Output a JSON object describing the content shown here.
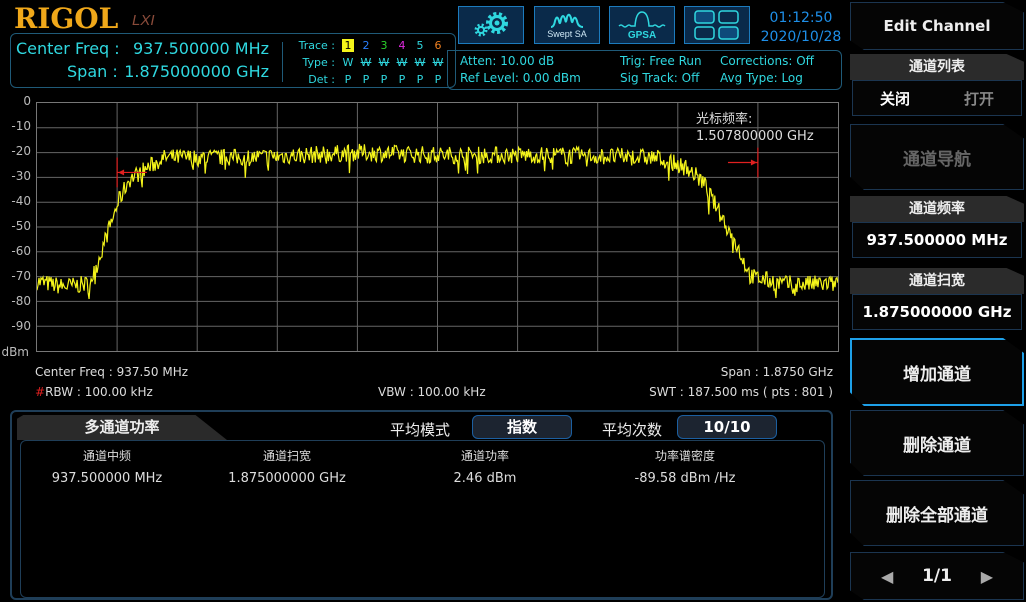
{
  "brand": {
    "logo": "RIGOL",
    "sub": "LXI"
  },
  "header": {
    "center_freq_label": "Center Freq :",
    "center_freq_value": "937.500000 MHz",
    "span_label": "Span :",
    "span_value": "1.875000000 GHz",
    "trace_label": "Trace :",
    "type_label": "Type :",
    "det_label": "Det :",
    "traces": [
      {
        "num": "1",
        "type": "W",
        "det": "P",
        "color": "#f5f51a",
        "active": true
      },
      {
        "num": "2",
        "type": "W",
        "det": "P",
        "color": "#2a7fff",
        "active": false
      },
      {
        "num": "3",
        "type": "W",
        "det": "P",
        "color": "#2ad02a",
        "active": false
      },
      {
        "num": "4",
        "type": "W",
        "det": "P",
        "color": "#e02ae0",
        "active": false
      },
      {
        "num": "5",
        "type": "W",
        "det": "P",
        "color": "#2fd8e0",
        "active": false
      },
      {
        "num": "6",
        "type": "W",
        "det": "P",
        "color": "#f08020",
        "active": false
      }
    ]
  },
  "toolbar": {
    "settings_icon": "gears-icon",
    "swept_sa_label": "Swept SA",
    "gpsa_label": "GPSA",
    "layout_icon": "window-layout-icon"
  },
  "clock": {
    "time": "01:12:50",
    "date": "2020/10/28"
  },
  "status": {
    "atten": "Atten: 10.00 dB",
    "ref_level": "Ref Level: 0.00 dBm",
    "trig": "Trig: Free Run",
    "sig_track": "Sig Track: Off",
    "corrections": "Corrections: Off",
    "avg_type": "Avg Type: Log"
  },
  "chart_data": {
    "type": "line",
    "title": "",
    "xlabel": "",
    "ylabel": "dBm",
    "ylim": [
      -100,
      0
    ],
    "yticks": [
      "0",
      "-10",
      "-20",
      "-30",
      "-40",
      "-50",
      "-60",
      "-70",
      "-80",
      "-90"
    ],
    "y_unit_label": "dBm",
    "x_range_ghz": [
      0,
      1.875
    ],
    "grid": true,
    "series": [
      {
        "name": "Trace 1",
        "color": "#f5f51a",
        "profile": [
          {
            "x": 0.0,
            "y": -72
          },
          {
            "x": 0.06,
            "y": -74
          },
          {
            "x": 0.12,
            "y": -73
          },
          {
            "x": 0.135,
            "y": -68
          },
          {
            "x": 0.16,
            "y": -55
          },
          {
            "x": 0.19,
            "y": -40
          },
          {
            "x": 0.215,
            "y": -31
          },
          {
            "x": 0.25,
            "y": -27
          },
          {
            "x": 0.3,
            "y": -22
          },
          {
            "x": 0.5,
            "y": -22
          },
          {
            "x": 0.75,
            "y": -20
          },
          {
            "x": 0.95,
            "y": -21
          },
          {
            "x": 1.2,
            "y": -21
          },
          {
            "x": 1.45,
            "y": -22
          },
          {
            "x": 1.52,
            "y": -26
          },
          {
            "x": 1.56,
            "y": -32
          },
          {
            "x": 1.6,
            "y": -45
          },
          {
            "x": 1.64,
            "y": -58
          },
          {
            "x": 1.67,
            "y": -70
          },
          {
            "x": 1.75,
            "y": -73
          },
          {
            "x": 1.875,
            "y": -73
          }
        ]
      }
    ],
    "markers": [
      {
        "type": "channel-edge-left",
        "x_ghz": 0.1875,
        "y": -28
      },
      {
        "type": "channel-edge-right",
        "x_ghz": 1.6875,
        "y": -24
      }
    ],
    "cursor_label": "光标频率:",
    "cursor_value": "1.507800000 GHz"
  },
  "sweep_info": {
    "center_freq": "Center Freq : 937.50 MHz",
    "span": "Span : 1.8750 GHz",
    "rbw_hash": "#",
    "rbw": "RBW : 100.00 kHz",
    "vbw": "VBW : 100.00 kHz",
    "swt": "SWT : 187.500 ms ( pts : 801 )"
  },
  "results": {
    "tab_label": "多通道功率",
    "avg_mode_label": "平均模式",
    "avg_mode_value": "指数",
    "avg_count_label": "平均次数",
    "avg_count_value": "10/10",
    "columns": [
      "通道中频",
      "通道扫宽",
      "通道功率",
      "功率谱密度"
    ],
    "rows": [
      [
        "937.500000 MHz",
        "1.875000000 GHz",
        "2.46 dBm",
        "-89.58 dBm /Hz"
      ]
    ]
  },
  "softkeys": {
    "title": "Edit Channel",
    "channel_list_label": "通道列表",
    "channel_list_off": "关闭",
    "channel_list_on": "打开",
    "channel_nav": "通道导航",
    "channel_freq_label": "通道频率",
    "channel_freq_value": "937.500000 MHz",
    "channel_span_label": "通道扫宽",
    "channel_span_value": "1.875000000 GHz",
    "add_channel": "增加通道",
    "delete_channel": "删除通道",
    "delete_all_channels": "删除全部通道",
    "page": "1/1"
  }
}
